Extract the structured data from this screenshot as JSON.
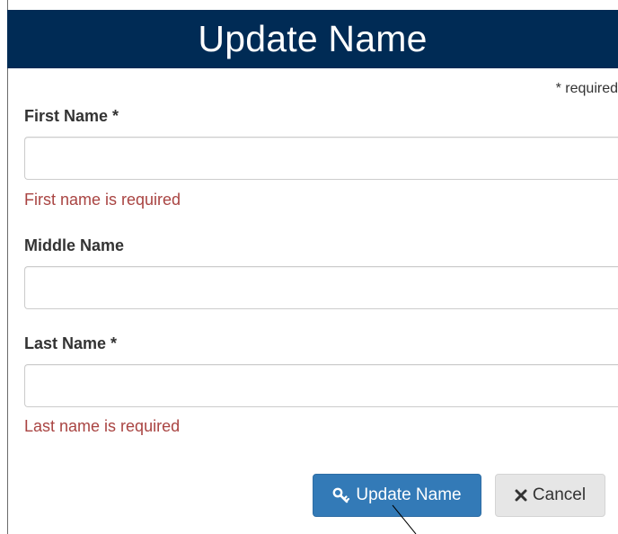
{
  "header": {
    "title": "Update Name"
  },
  "form": {
    "required_note": "* required",
    "first_name": {
      "label": "First Name *",
      "value": "",
      "error": "First name is required"
    },
    "middle_name": {
      "label": "Middle Name",
      "value": ""
    },
    "last_name": {
      "label": "Last Name *",
      "value": "",
      "error": "Last name is required"
    }
  },
  "actions": {
    "update_label": "Update Name",
    "update_icon": "key-icon",
    "cancel_label": "Cancel",
    "cancel_icon": "close-icon"
  },
  "colors": {
    "header_bg": "#002b55",
    "primary": "#337ab7",
    "error": "#a94442"
  }
}
